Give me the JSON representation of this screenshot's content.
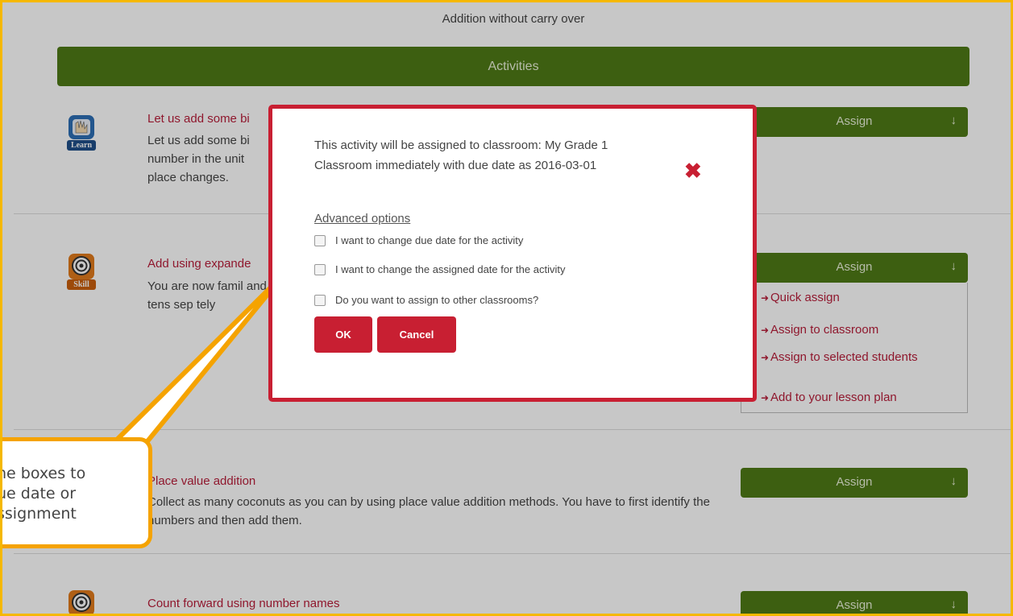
{
  "page": {
    "subtitle": "Addition without carry over",
    "activities_header": "Activities"
  },
  "activities": [
    {
      "icon": "learn-icon",
      "badge": "Learn",
      "title": "Let us add some bi",
      "desc": "Let us add some bi number in the unit place changes.",
      "assign_label": "Assign"
    },
    {
      "icon": "skill-target-icon",
      "badge": "Skill",
      "title": "Add using expande",
      "desc": "You are now famil and tens sep   tely",
      "assign_label": "Assign"
    },
    {
      "icon": "skill-target-icon",
      "badge": "",
      "title": "Place value addition",
      "desc": "Collect as many coconuts as you can by using place value addition methods. You have to first identify the numbers and then add them.",
      "assign_label": "Assign"
    },
    {
      "icon": "skill-target-icon",
      "badge": "",
      "title": "Count forward using number names",
      "desc": "",
      "assign_label": "Assign"
    }
  ],
  "assign_dropdown": {
    "items": [
      "Quick assign",
      "Assign to classroom",
      "Assign to selected students",
      "Add to your lesson plan"
    ]
  },
  "modal": {
    "message": "This activity will be assigned to classroom: My Grade 1 Classroom immediately with due date as 2016-03-01",
    "close_symbol": "✖",
    "advanced_title": "Advanced options",
    "options": [
      "I want to change due date for the activity",
      "I want to change the assigned date for the activity",
      "Do you want to assign to other classrooms?"
    ],
    "ok_label": "OK",
    "cancel_label": "Cancel"
  },
  "callout": {
    "lines": [
      "he boxes to",
      "ue date or",
      "ssignment"
    ]
  },
  "colors": {
    "green": "#4f7a16",
    "red": "#c81f32",
    "link_red": "#b81e3a",
    "callout_orange": "#f5a300",
    "frame_yellow": "#f5b800"
  }
}
